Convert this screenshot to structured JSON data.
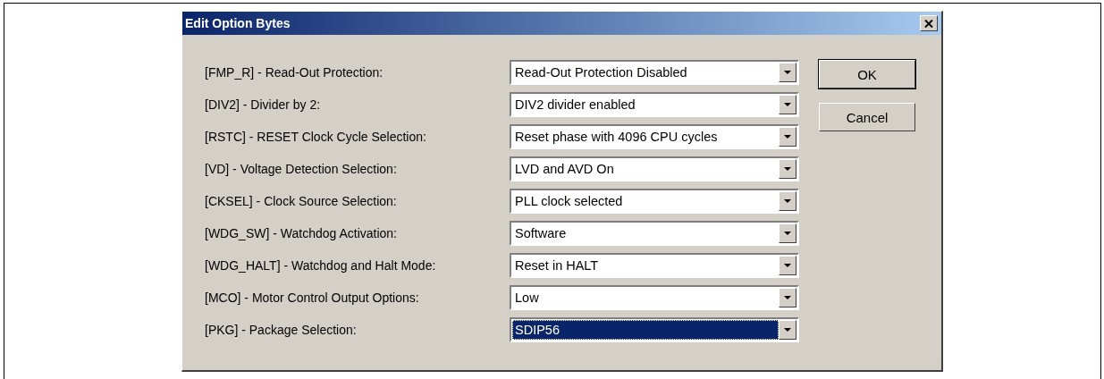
{
  "window": {
    "title": "Edit Option Bytes"
  },
  "options": [
    {
      "label": "[FMP_R] - Read-Out Protection:",
      "value": "Read-Out Protection Disabled",
      "focused": false
    },
    {
      "label": "[DIV2] - Divider by 2:",
      "value": "DIV2 divider enabled",
      "focused": false
    },
    {
      "label": "[RSTC] - RESET Clock Cycle Selection:",
      "value": "Reset phase with 4096 CPU cycles",
      "focused": false
    },
    {
      "label": "[VD] - Voltage Detection Selection:",
      "value": "LVD and AVD On",
      "focused": false
    },
    {
      "label": "[CKSEL] - Clock Source Selection:",
      "value": "PLL clock selected",
      "focused": false
    },
    {
      "label": "[WDG_SW] - Watchdog Activation:",
      "value": "Software",
      "focused": false
    },
    {
      "label": "[WDG_HALT] - Watchdog and Halt Mode:",
      "value": "Reset in HALT",
      "focused": false
    },
    {
      "label": "[MCO] - Motor Control Output Options:",
      "value": "Low",
      "focused": false
    },
    {
      "label": "[PKG] - Package Selection:",
      "value": "SDIP56",
      "focused": true
    }
  ],
  "buttons": [
    {
      "label": "OK",
      "kind": "default"
    },
    {
      "label": "Cancel",
      "kind": "normal"
    }
  ]
}
